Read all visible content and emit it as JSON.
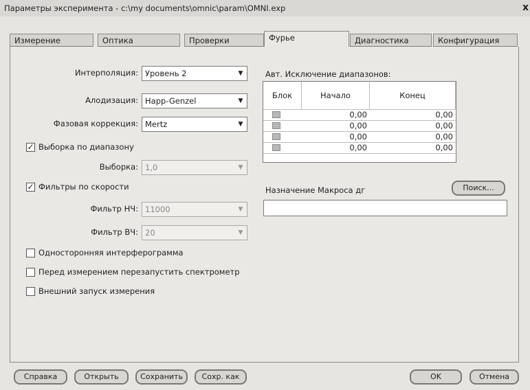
{
  "window": {
    "title": "Параметры эксперимента - c:\\my documents\\omnic\\param\\OMNI.exp",
    "close_glyph": "x"
  },
  "tabs": [
    {
      "label": "Измерение"
    },
    {
      "label": "Оптика"
    },
    {
      "label": "Проверки"
    },
    {
      "label": "Фурье"
    },
    {
      "label": "Диагностика"
    },
    {
      "label": "Конфигурация"
    }
  ],
  "form": {
    "interpolation": {
      "label": "Интерполяция:",
      "value": "Уровень 2"
    },
    "apodization": {
      "label": "Алодизация:",
      "value": "Happ-Genzel"
    },
    "phase_correction": {
      "label": "Фазовая коррекция:",
      "value": "Mertz"
    },
    "range_sampling": {
      "label": "Выборка по диапазону",
      "checked": true
    },
    "sampling": {
      "label": "Выборка:",
      "value": "1,0"
    },
    "speed_filters": {
      "label": "Фильтры по скорости",
      "checked": true
    },
    "low_filter": {
      "label": "Фильтр НЧ:",
      "value": "11000"
    },
    "high_filter": {
      "label": "Фильтр ВЧ:",
      "value": "20"
    },
    "one_sided": {
      "label": "Односторонняя интерферограмма",
      "checked": false
    },
    "restart_spectrometer": {
      "label": "Перед измерением перезапустить спектрометр",
      "checked": false
    },
    "external_trigger": {
      "label": "Внешний запуск измерения",
      "checked": false
    }
  },
  "exclusion": {
    "title": "Авт. Исключение диапазонов:",
    "columns": [
      "Блок",
      "Начало",
      "Конец"
    ],
    "rows": [
      {
        "start": "0,00",
        "end": "0,00"
      },
      {
        "start": "0,00",
        "end": "0,00"
      },
      {
        "start": "0,00",
        "end": "0,00"
      },
      {
        "start": "0,00",
        "end": "0,00"
      }
    ]
  },
  "macro": {
    "label": "Назначение Макроса дг",
    "browse_label": "Поиск...",
    "value": ""
  },
  "buttons": {
    "help": "Справка",
    "open": "Открыть",
    "save": "Сохранить",
    "save_as": "Сохр. как",
    "ok": "OK",
    "cancel": "Отмена"
  }
}
